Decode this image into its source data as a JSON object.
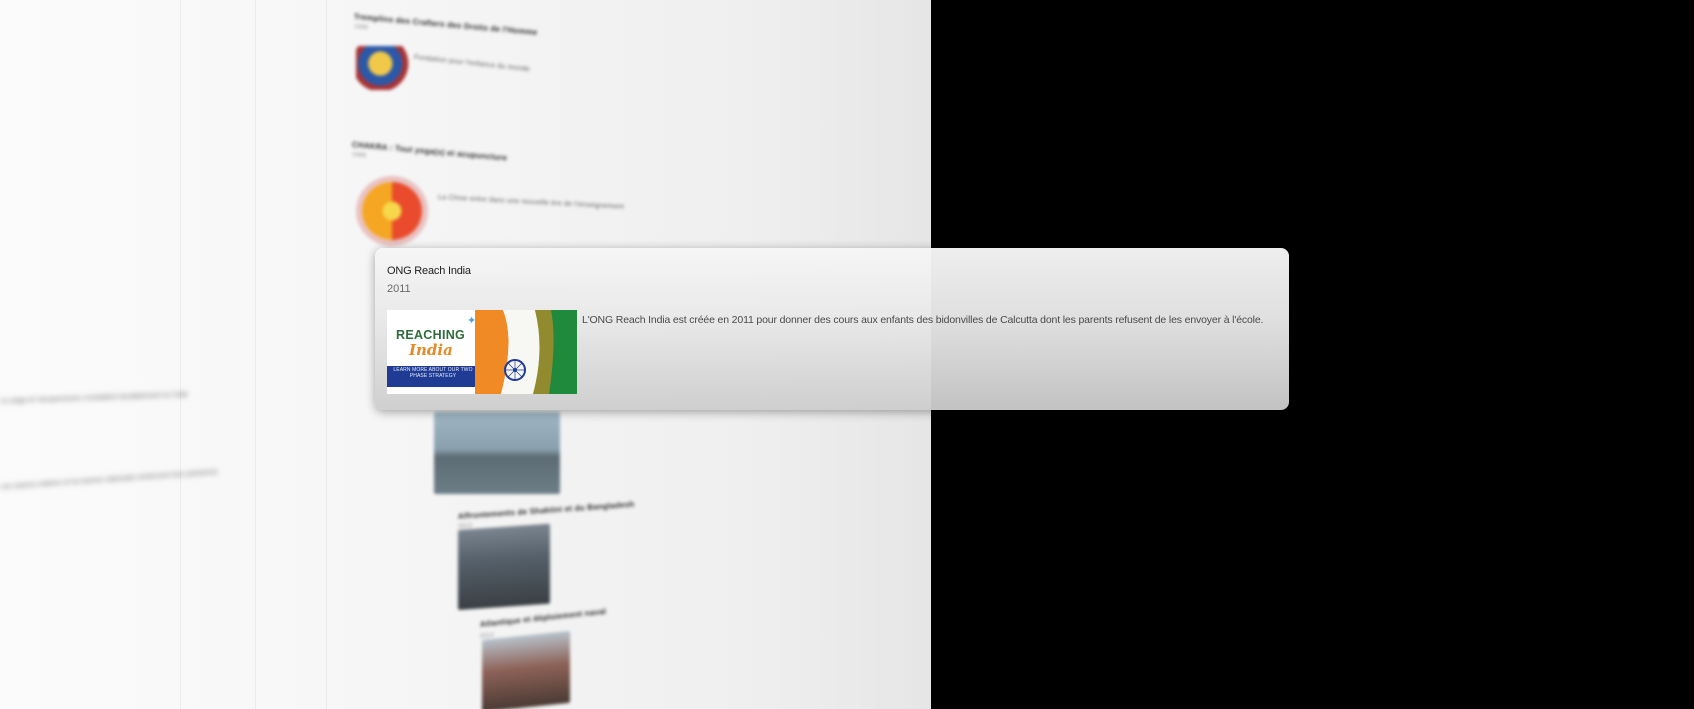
{
  "background_timeline": {
    "entries": [
      {
        "title": "Tremplins des Crafters des Droits de l'Homme",
        "year": "1995"
      },
      {
        "title": "Fondation pour l'enfance du monde",
        "year": ""
      },
      {
        "title": "CHAKRA : Tout yoga(s) et acupuncture",
        "year": "1989"
      },
      {
        "title": "Affrontements de Shaktini et du Bangladesh",
        "year": "2013"
      },
      {
        "title": "Atlantique et déploiement naval",
        "year": "2014"
      }
    ],
    "snippets": [
      "La Chine entre dans une nouvelle ère de l'enseignement",
      "Le yoga et l'acupuncture s'installent durablement en Inde",
      "Les marins indiens et la marine nationale renforcent leur présence"
    ]
  },
  "popover": {
    "title": "ONG Reach India",
    "year": "2011",
    "description": "L'ONG Reach India est créée en 2011 pour donner des cours aux enfants des bidonvilles de Calcutta dont les parents refusent de les envoyer à l'école.",
    "image": {
      "word1": "REACHING",
      "word2": "India",
      "band_text": "LEARN MORE ABOUT OUR TWO PHASE STRATEGY",
      "colors": {
        "saffron": "#f08a24",
        "white": "#ffffff",
        "green": "#1f8a3b",
        "chakra": "#1f3b94",
        "band": "#1f3b94"
      }
    }
  },
  "colors": {
    "background": "#000000",
    "page": "#f5f5f5",
    "card_top": "#f6f6f6",
    "card_bottom": "#cdcdcd",
    "title_text": "#1e1e1e",
    "muted_text": "#6a6a6a"
  }
}
